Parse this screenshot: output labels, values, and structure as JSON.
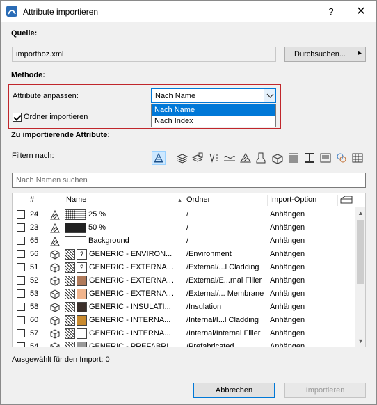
{
  "window": {
    "title": "Attribute importieren",
    "help": "?",
    "close": "✕"
  },
  "source": {
    "label": "Quelle:",
    "file": "importhoz.xml",
    "browse_label": "Durchsuchen...",
    "browse_arrow": "▸"
  },
  "method": {
    "label": "Methode:",
    "match_label": "Attribute anpassen:",
    "match_value": "Nach Name",
    "options": [
      "Nach Name",
      "Nach Index"
    ],
    "import_folders_label": "Ordner importieren",
    "import_folders_checked": true
  },
  "attributes": {
    "label": "Zu importierende Attribute:",
    "filter_label": "Filtern nach:",
    "filter_icons": [
      "all-attributes-icon",
      "layers-icon",
      "layer-combinations-icon",
      "pens-icon",
      "line-types-icon",
      "fill-types-icon",
      "surfaces-icon",
      "building-materials-icon",
      "composites-icon",
      "profiles-icon",
      "zones-icon",
      "mep-systems-icon",
      "operation-profiles-icon"
    ],
    "search_placeholder": "Nach Namen suchen"
  },
  "table": {
    "headers": {
      "index": "#",
      "name": "Name",
      "folder": "Ordner",
      "option": "Import-Option"
    },
    "rows": [
      {
        "index": "24",
        "type": "fill",
        "name": "25 %",
        "folder": "/",
        "option": "Anhängen",
        "swatch": "dots"
      },
      {
        "index": "23",
        "type": "fill",
        "name": "50 %",
        "folder": "/",
        "option": "Anhängen",
        "swatch": "dense"
      },
      {
        "index": "65",
        "type": "fill",
        "name": "Background",
        "folder": "/",
        "option": "Anhängen",
        "swatch": "white"
      },
      {
        "index": "56",
        "type": "material",
        "name": "GENERIC - ENVIRON...",
        "folder": "/Environment",
        "option": "Anhängen",
        "swatch": "question",
        "color": "#ffffff"
      },
      {
        "index": "51",
        "type": "material",
        "name": "GENERIC - EXTERNA...",
        "folder": "/External/...l Cladding",
        "option": "Anhängen",
        "swatch": "question",
        "color": "#ffffff"
      },
      {
        "index": "52",
        "type": "material",
        "name": "GENERIC - EXTERNA...",
        "folder": "/External/E...rnal Filler",
        "option": "Anhängen",
        "swatch": "hatch",
        "color": "#b07a5a"
      },
      {
        "index": "53",
        "type": "material",
        "name": "GENERIC - EXTERNA...",
        "folder": "/External/... Membrane",
        "option": "Anhängen",
        "swatch": "hatch",
        "color": "#f1b48c"
      },
      {
        "index": "58",
        "type": "material",
        "name": "GENERIC - INSULATI...",
        "folder": "/Insulation",
        "option": "Anhängen",
        "swatch": "hatch",
        "color": "#3b2f2a"
      },
      {
        "index": "60",
        "type": "material",
        "name": "GENERIC - INTERNA...",
        "folder": "/Internal/I...l Cladding",
        "option": "Anhängen",
        "swatch": "hatch",
        "color": "#c98a2e"
      },
      {
        "index": "57",
        "type": "material",
        "name": "GENERIC - INTERNA...",
        "folder": "/Internal/Internal Filler",
        "option": "Anhängen",
        "swatch": "hatch",
        "color": "#ffffff"
      },
      {
        "index": "54",
        "type": "material",
        "name": "GENERIC - PREFABRI...",
        "folder": "/Prefabricated",
        "option": "Anhängen",
        "swatch": "hatch",
        "color": "#9a9a9a"
      }
    ]
  },
  "footer": {
    "selected_label": "Ausgewählt für den Import: 0",
    "cancel_label": "Abbrechen",
    "import_label": "Importieren"
  }
}
